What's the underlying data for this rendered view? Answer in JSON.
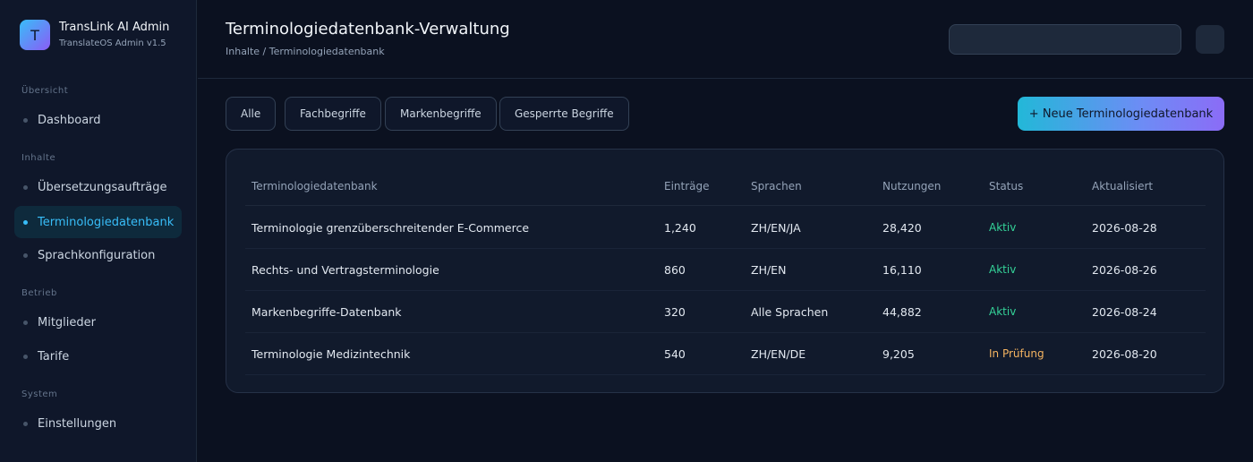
{
  "app": {
    "logo_letter": "T",
    "title": "TransLink AI Admin",
    "subtitle": "TranslateOS Admin v1.5"
  },
  "sidebar": {
    "sections": [
      {
        "label": "Übersicht",
        "items": [
          {
            "label": "Dashboard",
            "active": false
          }
        ]
      },
      {
        "label": "Inhalte",
        "items": [
          {
            "label": "Übersetzungsaufträge",
            "active": false
          },
          {
            "label": "Terminologiedatenbank",
            "active": true
          },
          {
            "label": "Sprachkonfiguration",
            "active": false
          }
        ]
      },
      {
        "label": "Betrieb",
        "items": [
          {
            "label": "Mitglieder",
            "active": false
          },
          {
            "label": "Tarife",
            "active": false
          }
        ]
      },
      {
        "label": "System",
        "items": [
          {
            "label": "Einstellungen",
            "active": false
          }
        ]
      }
    ]
  },
  "header": {
    "title": "Terminologiedatenbank-Verwaltung",
    "breadcrumb": "Inhalte / Terminologiedatenbank",
    "search_value": ""
  },
  "filters": [
    "Alle",
    "Fachbegriffe",
    "Markenbegriffe",
    "Gesperrte Begriffe"
  ],
  "add_button_label": "+ Neue Terminologiedatenbank",
  "table": {
    "columns": [
      "Terminologiedatenbank",
      "Einträge",
      "Sprachen",
      "Nutzungen",
      "Status",
      "Aktualisiert"
    ],
    "rows": [
      {
        "name": "Terminologie grenzüberschreitender E-Commerce",
        "entries": "1,240",
        "languages": "ZH/EN/JA",
        "usage": "28,420",
        "status": "Aktiv",
        "updated": "2026-08-28"
      },
      {
        "name": "Rechts- und Vertragsterminologie",
        "entries": "860",
        "languages": "ZH/EN",
        "usage": "16,110",
        "status": "Aktiv",
        "updated": "2026-08-26"
      },
      {
        "name": "Markenbegriffe-Datenbank",
        "entries": "320",
        "languages": "Alle Sprachen",
        "usage": "44,882",
        "status": "Aktiv",
        "updated": "2026-08-24"
      },
      {
        "name": "Terminologie Medizintechnik",
        "entries": "540",
        "languages": "ZH/EN/DE",
        "usage": "9,205",
        "status": "In Prüfung",
        "updated": "2026-08-20"
      }
    ]
  },
  "colors": {
    "accent": "#38bdf8",
    "status_active": "#34d399",
    "status_review": "#f5b461"
  },
  "icons": {
    "header_button": "blank-icon"
  }
}
